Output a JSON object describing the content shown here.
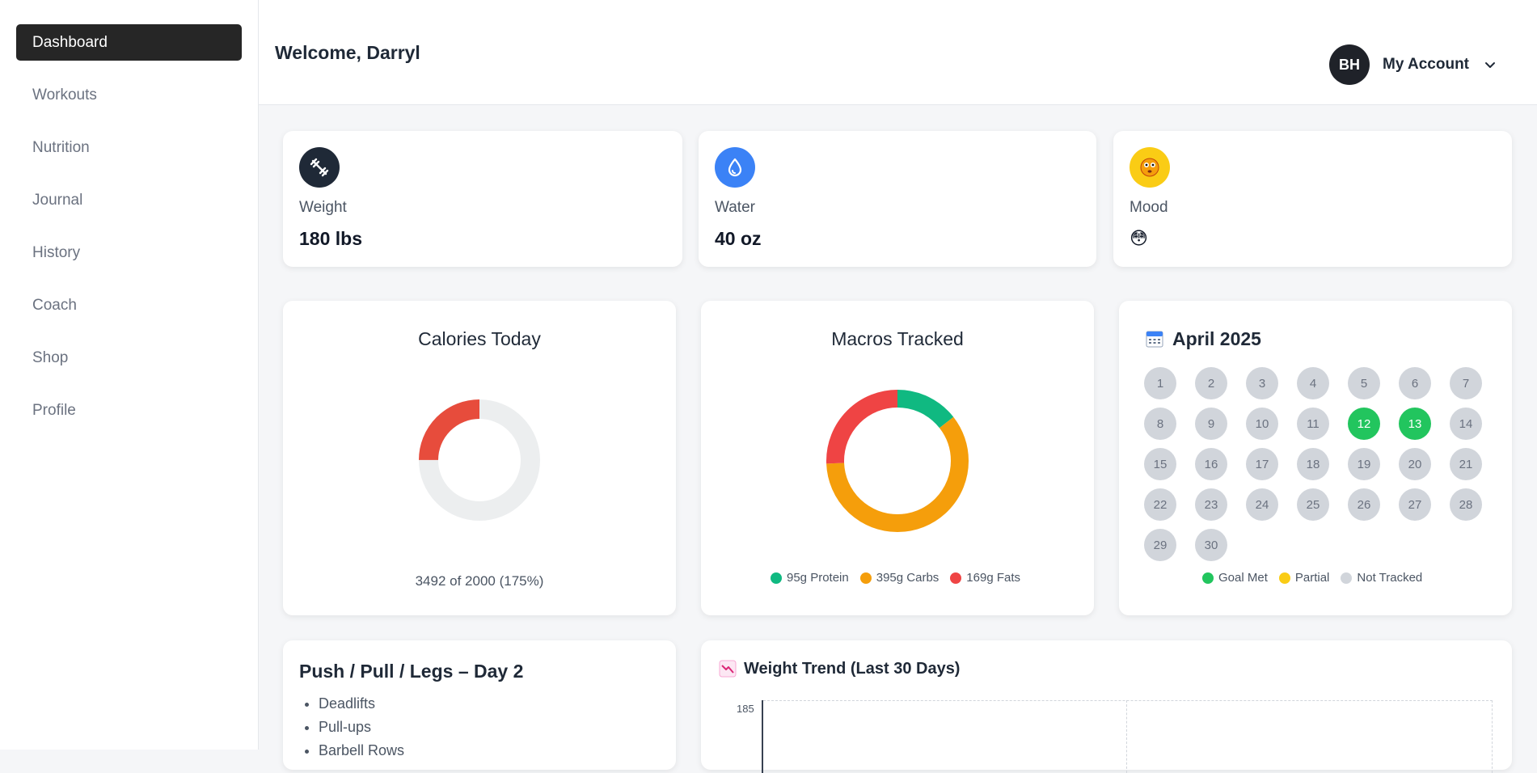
{
  "sidebar": {
    "items": [
      {
        "label": "Dashboard",
        "active": true
      },
      {
        "label": "Workouts"
      },
      {
        "label": "Nutrition"
      },
      {
        "label": "Journal"
      },
      {
        "label": "History"
      },
      {
        "label": "Coach"
      },
      {
        "label": "Shop"
      },
      {
        "label": "Profile"
      }
    ]
  },
  "header": {
    "welcome": "Welcome, Darryl",
    "avatar_initials": "BH",
    "account_label": "My Account"
  },
  "stats": {
    "weight": {
      "label": "Weight",
      "value": "180 lbs",
      "icon": "dumbbell-icon",
      "color": "#1f2937"
    },
    "water": {
      "label": "Water",
      "value": "40 oz",
      "icon": "droplet-icon",
      "color": "#3b82f6"
    },
    "mood": {
      "label": "Mood",
      "value": "😳",
      "icon": "smiley-icon",
      "color": "#facc15"
    }
  },
  "calories": {
    "title": "Calories Today",
    "summary": "3492 of 2000 (175%)",
    "consumed": 3492,
    "goal": 2000,
    "fill_fraction": 0.25,
    "color": "#e74c3c",
    "track_color": "#eceeef"
  },
  "macros": {
    "title": "Macros Tracked",
    "segments": [
      {
        "label": "95g Protein",
        "value": 95,
        "color": "#10b981"
      },
      {
        "label": "395g Carbs",
        "value": 395,
        "color": "#f59e0b"
      },
      {
        "label": "169g Fats",
        "value": 169,
        "color": "#ef4444"
      }
    ]
  },
  "calendar": {
    "title": "April 2025",
    "days": [
      "1",
      "2",
      "3",
      "4",
      "5",
      "6",
      "7",
      "8",
      "9",
      "10",
      "11",
      "12",
      "13",
      "14",
      "15",
      "16",
      "17",
      "18",
      "19",
      "20",
      "21",
      "22",
      "23",
      "24",
      "25",
      "26",
      "27",
      "28",
      "29",
      "30"
    ],
    "goal_met_days": [
      "12",
      "13"
    ],
    "legend": [
      {
        "label": "Goal Met",
        "color": "#22c55e"
      },
      {
        "label": "Partial",
        "color": "#facc15"
      },
      {
        "label": "Not Tracked",
        "color": "#d1d5db"
      }
    ]
  },
  "workout": {
    "title": "Push / Pull / Legs – Day 2",
    "exercises": [
      "Deadlifts",
      "Pull-ups",
      "Barbell Rows"
    ]
  },
  "weight_trend": {
    "title": "Weight Trend (Last 30 Days)",
    "y_tick_top": "185"
  }
}
